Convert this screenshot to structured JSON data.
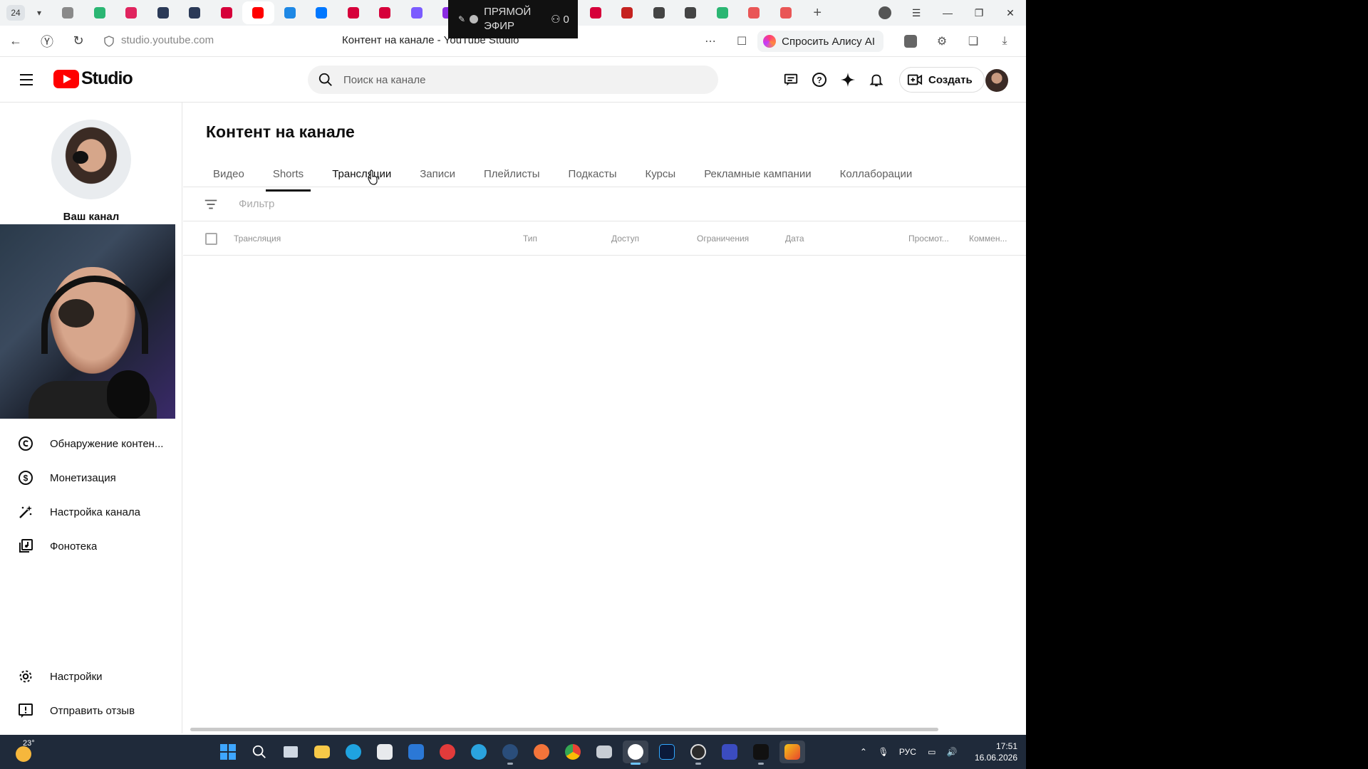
{
  "browser": {
    "tab_count": "24",
    "url": "studio.youtube.com",
    "page_title": "Контент на канале - YouTube Studio",
    "alice_label": "Спросить Алису AI",
    "favicons": [
      "#8a8a8a",
      "#2bb673",
      "#e0245e",
      "#2b3a57",
      "#2b3a57",
      "#d6003a",
      "#ff0000",
      "#1e88e5",
      "#0077ff",
      "#d6003a",
      "#d6003a",
      "#7b5cff",
      "#8a2be2"
    ],
    "favicons_right": [
      "#d6003a",
      "#c5221f",
      "#444444",
      "#444444",
      "#2bb673",
      "#e95656",
      "#e95656"
    ]
  },
  "live_overlay": {
    "label": "ПРЯМОЙ ЭФИР",
    "viewers": "0"
  },
  "header": {
    "brand": "Studio",
    "search_placeholder": "Поиск на канале",
    "create_label": "Создать"
  },
  "sidebar": {
    "channel_label": "Ваш канал",
    "items": [
      {
        "label": "Обнаружение контен...",
        "icon": "copyright-icon"
      },
      {
        "label": "Монетизация",
        "icon": "dollar-icon"
      },
      {
        "label": "Настройка канала",
        "icon": "magic-wand-icon"
      },
      {
        "label": "Фонотека",
        "icon": "audio-library-icon"
      }
    ],
    "bottom_items": [
      {
        "label": "Настройки",
        "icon": "gear-icon"
      },
      {
        "label": "Отправить отзыв",
        "icon": "feedback-icon"
      }
    ]
  },
  "main": {
    "title": "Контент на канале",
    "tabs": [
      {
        "label": "Видео"
      },
      {
        "label": "Shorts"
      },
      {
        "label": "Трансляции"
      },
      {
        "label": "Записи"
      },
      {
        "label": "Плейлисты"
      },
      {
        "label": "Подкасты"
      },
      {
        "label": "Курсы"
      },
      {
        "label": "Рекламные кампании"
      },
      {
        "label": "Коллаборации"
      }
    ],
    "active_tab_index": 1,
    "filter_placeholder": "Фильтр",
    "columns": {
      "stream": "Трансляция",
      "type": "Тип",
      "access": "Доступ",
      "restrictions": "Ограничения",
      "date": "Дата",
      "views": "Просмот...",
      "comments": "Коммен..."
    }
  },
  "taskbar": {
    "temperature": "23°",
    "lang": "РУС",
    "time": "17:51",
    "date": "16.06.2026"
  },
  "colors": {
    "brand_red": "#ff0000",
    "taskbar": "#1f2a3a",
    "text_primary": "#0f0f0f",
    "text_secondary": "#606060"
  }
}
